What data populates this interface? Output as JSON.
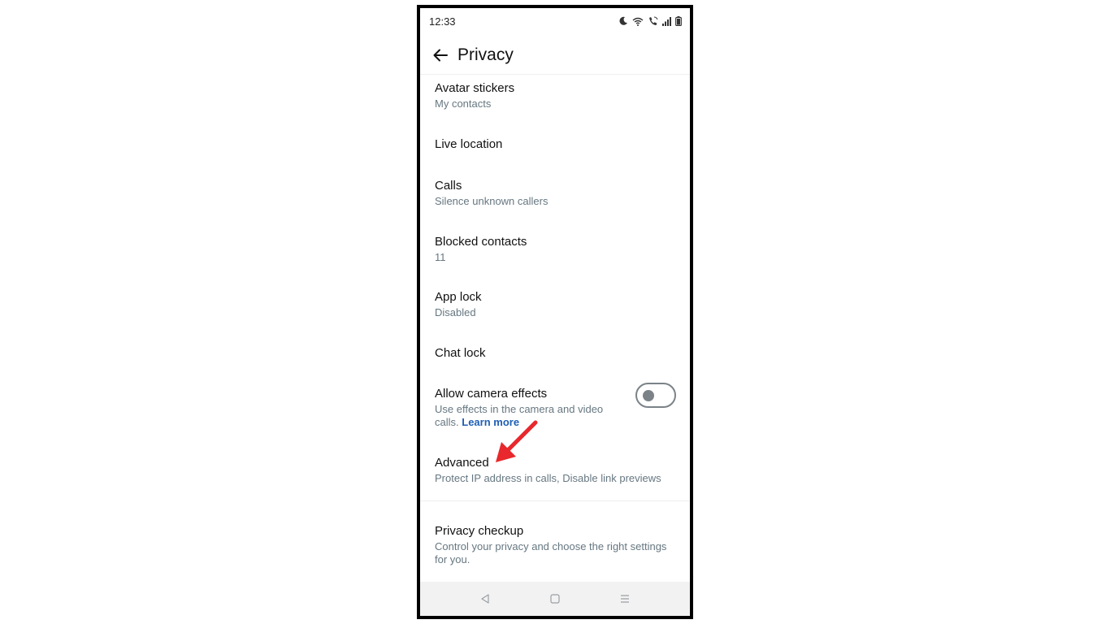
{
  "status": {
    "time": "12:33"
  },
  "header": {
    "title": "Privacy"
  },
  "items": [
    {
      "title": "Avatar stickers",
      "subtitle": "My contacts"
    },
    {
      "title": "Live location"
    },
    {
      "title": "Calls",
      "subtitle": "Silence unknown callers"
    },
    {
      "title": "Blocked contacts",
      "subtitle": "11"
    },
    {
      "title": "App lock",
      "subtitle": "Disabled"
    },
    {
      "title": "Chat lock"
    }
  ],
  "camera_effects": {
    "title": "Allow camera effects",
    "subtitle": "Use effects in the camera and video calls.",
    "link": "Learn more",
    "enabled": false
  },
  "advanced": {
    "title": "Advanced",
    "subtitle": "Protect IP address in calls, Disable link previews"
  },
  "privacy_checkup": {
    "title": "Privacy checkup",
    "subtitle": "Control your privacy and choose the right settings for you."
  },
  "colors": {
    "annotation_arrow": "#e8282c",
    "link": "#1f5fb4"
  }
}
